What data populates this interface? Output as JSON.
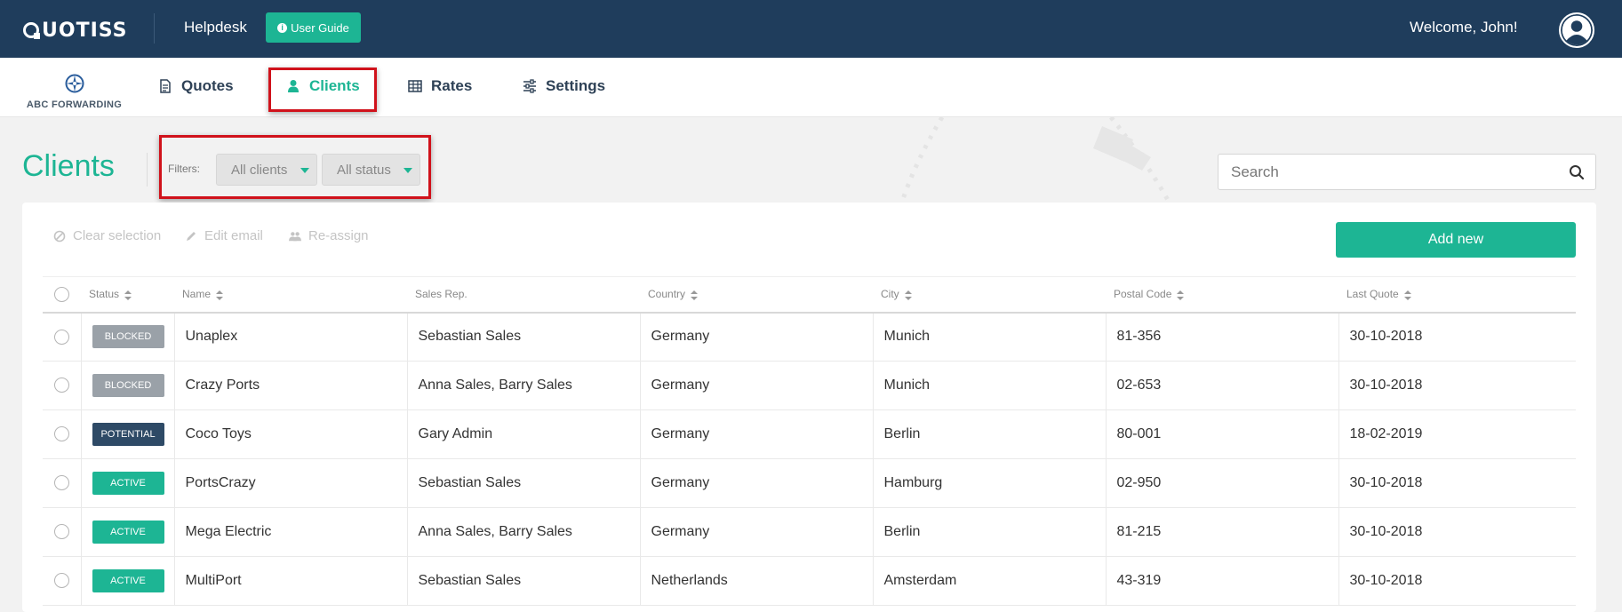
{
  "topbar": {
    "brand": "QUOTISS",
    "helpdesk": "Helpdesk",
    "user_guide": "User Guide",
    "welcome": "Welcome, John!"
  },
  "nav": {
    "company": "ABC FORWARDING",
    "items": [
      {
        "label": "Quotes",
        "icon": "document-icon"
      },
      {
        "label": "Clients",
        "icon": "user-icon",
        "active": true
      },
      {
        "label": "Rates",
        "icon": "table-icon"
      },
      {
        "label": "Settings",
        "icon": "sliders-icon"
      }
    ]
  },
  "page": {
    "title": "Clients",
    "filters_label": "Filters:",
    "filter_clients": "All clients",
    "filter_status": "All status",
    "search_placeholder": "Search"
  },
  "actions": {
    "clear_selection": "Clear selection",
    "edit_email": "Edit email",
    "reassign": "Re-assign",
    "add_new": "Add new"
  },
  "table": {
    "columns": [
      "Status",
      "Name",
      "Sales Rep.",
      "Country",
      "City",
      "Postal Code",
      "Last Quote"
    ],
    "rows": [
      {
        "status": "BLOCKED",
        "name": "Unaplex",
        "sales_rep": "Sebastian Sales",
        "country": "Germany",
        "city": "Munich",
        "postal": "81-356",
        "last_quote": "30-10-2018"
      },
      {
        "status": "BLOCKED",
        "name": "Crazy Ports",
        "sales_rep": "Anna Sales, Barry Sales",
        "country": "Germany",
        "city": "Munich",
        "postal": "02-653",
        "last_quote": "30-10-2018"
      },
      {
        "status": "POTENTIAL",
        "name": "Coco Toys",
        "sales_rep": "Gary Admin",
        "country": "Germany",
        "city": "Berlin",
        "postal": "80-001",
        "last_quote": "18-02-2019"
      },
      {
        "status": "ACTIVE",
        "name": "PortsCrazy",
        "sales_rep": "Sebastian Sales",
        "country": "Germany",
        "city": "Hamburg",
        "postal": "02-950",
        "last_quote": "30-10-2018"
      },
      {
        "status": "ACTIVE",
        "name": "Mega Electric",
        "sales_rep": "Anna Sales, Barry Sales",
        "country": "Germany",
        "city": "Berlin",
        "postal": "81-215",
        "last_quote": "30-10-2018"
      },
      {
        "status": "ACTIVE",
        "name": "MultiPort",
        "sales_rep": "Sebastian Sales",
        "country": "Netherlands",
        "city": "Amsterdam",
        "postal": "43-319",
        "last_quote": "30-10-2018"
      }
    ]
  },
  "colors": {
    "topbar": "#1f3d5c",
    "accent": "#1db594",
    "blocked": "#9aa1a8",
    "potential": "#2e4a66",
    "active": "#1db594",
    "highlight": "#d0121b"
  }
}
